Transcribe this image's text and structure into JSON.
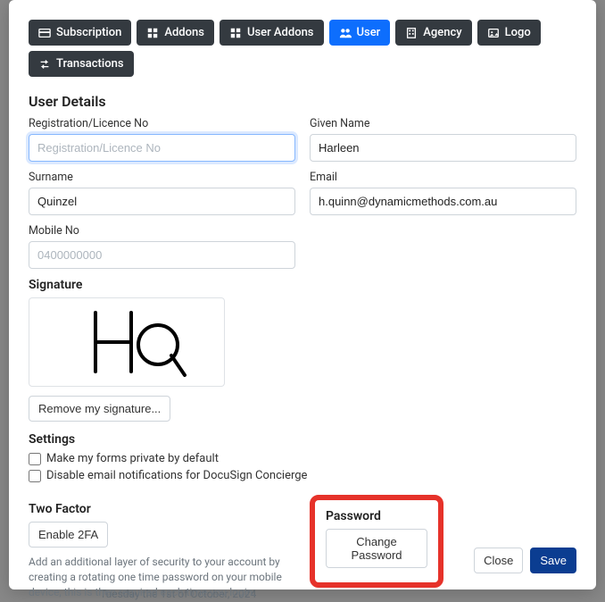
{
  "tabs": {
    "subscription": "Subscription",
    "addons": "Addons",
    "user_addons": "User Addons",
    "user": "User",
    "agency": "Agency",
    "logo": "Logo",
    "transactions": "Transactions"
  },
  "section": {
    "user_details": "User Details",
    "settings": "Settings",
    "two_factor": "Two Factor",
    "password": "Password",
    "signature": "Signature"
  },
  "labels": {
    "reg_no": "Registration/Licence No",
    "given_name": "Given Name",
    "surname": "Surname",
    "email": "Email",
    "mobile": "Mobile No"
  },
  "values": {
    "reg_no": "",
    "given_name": "Harleen",
    "surname": "Quinzel",
    "email": "h.quinn@dynamicmethods.com.au",
    "mobile": ""
  },
  "placeholders": {
    "reg_no": "Registration/Licence No",
    "mobile": "0400000000"
  },
  "buttons": {
    "remove_signature": "Remove my signature...",
    "enable_2fa": "Enable 2FA",
    "change_password": "Change Password",
    "close": "Close",
    "save": "Save"
  },
  "settings": {
    "private_default": "Make my forms private by default",
    "disable_docusign_emails": "Disable email notifications for DocuSign Concierge"
  },
  "help": {
    "two_factor": "Add an additional layer of security to your account by creating a rotating one time password on your mobile device, this is then required each time you login."
  },
  "behind": "Tuesday the 1st of October, 2024"
}
